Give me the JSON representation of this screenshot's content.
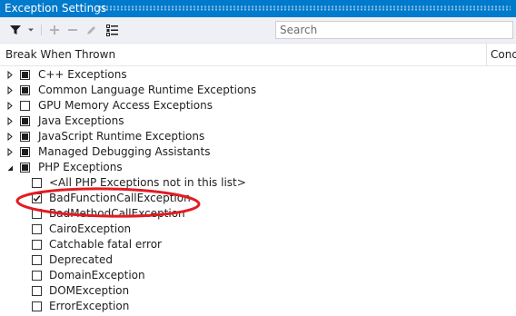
{
  "window": {
    "title": "Exception Settings"
  },
  "toolbar": {
    "buttons": [
      {
        "name": "filter-icon"
      },
      {
        "name": "dropdown-arrow-icon"
      },
      {
        "name": "add-icon"
      },
      {
        "name": "remove-icon"
      },
      {
        "name": "edit-icon"
      },
      {
        "name": "restore-list-icon"
      }
    ],
    "search": {
      "placeholder": "Search",
      "value": ""
    }
  },
  "columns": {
    "col1": "Break When Thrown",
    "col2": "Cond"
  },
  "categories": [
    {
      "label": "C++ Exceptions",
      "state": "partial",
      "expanded": false
    },
    {
      "label": "Common Language Runtime Exceptions",
      "state": "partial",
      "expanded": false
    },
    {
      "label": "GPU Memory Access Exceptions",
      "state": "unchecked",
      "expanded": false
    },
    {
      "label": "Java Exceptions",
      "state": "partial",
      "expanded": false
    },
    {
      "label": "JavaScript Runtime Exceptions",
      "state": "partial",
      "expanded": false
    },
    {
      "label": "Managed Debugging Assistants",
      "state": "partial",
      "expanded": false
    },
    {
      "label": "PHP Exceptions",
      "state": "partial",
      "expanded": true
    }
  ],
  "php_children": [
    {
      "label": "<All PHP Exceptions not in this list>",
      "state": "unchecked"
    },
    {
      "label": "BadFunctionCallException",
      "state": "checked"
    },
    {
      "label": "BadMethodCallException",
      "state": "unchecked"
    },
    {
      "label": "CairoException",
      "state": "unchecked"
    },
    {
      "label": "Catchable fatal error",
      "state": "unchecked"
    },
    {
      "label": "Deprecated",
      "state": "unchecked"
    },
    {
      "label": "DomainException",
      "state": "unchecked"
    },
    {
      "label": "DOMException",
      "state": "unchecked"
    },
    {
      "label": "ErrorException",
      "state": "unchecked"
    }
  ],
  "colors": {
    "titlebar": "#007acc",
    "toolbar": "#eef0f5",
    "annotation": "#e31b23"
  }
}
